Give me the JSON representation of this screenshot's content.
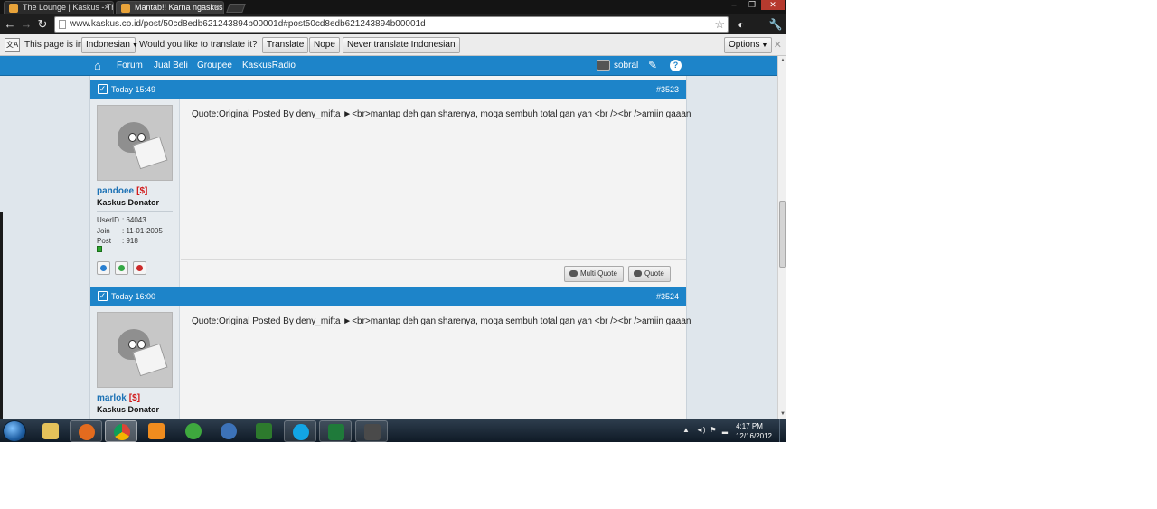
{
  "browser": {
    "tabs": [
      {
        "title": "The Lounge | Kaskus - The",
        "active": false
      },
      {
        "title": "Mantab!! Karna ngaskus d",
        "active": true
      }
    ],
    "url": "www.kaskus.co.id/post/50cd8edb621243894b00001d#post50cd8edb621243894b00001d"
  },
  "translate_bar": {
    "prefix": "This page is in",
    "language": "Indonesian",
    "question": "Would you like to translate it?",
    "translate_label": "Translate",
    "nope_label": "Nope",
    "never_label": "Never translate Indonesian",
    "options_label": "Options"
  },
  "site_nav": {
    "links": [
      "Forum",
      "Jual Beli",
      "Groupee",
      "KaskusRadio"
    ],
    "username": "sobral"
  },
  "posts": [
    {
      "time": "Today 15:49",
      "number": "#3523",
      "user": {
        "name": "pandoee",
        "tag": "[$]",
        "rank": "Kaskus Donator",
        "stats": [
          {
            "key": "UserID",
            "value": ": 64043"
          },
          {
            "key": "Join",
            "value": ": 11-01-2005"
          },
          {
            "key": "Post",
            "value": ": 918"
          }
        ]
      },
      "text": "Quote:Original Posted By deny_mifta ►<br>mantap deh gan sharenya, moga sembuh total gan yah <br /><br />amiin gaaan",
      "buttons": {
        "multi_quote": "Multi Quote",
        "quote": "Quote"
      }
    },
    {
      "time": "Today 16:00",
      "number": "#3524",
      "user": {
        "name": "marlok",
        "tag": "[$]",
        "rank": "Kaskus Donator"
      },
      "text": "Quote:Original Posted By deny_mifta ►<br>mantap deh gan sharenya, moga sembuh total gan yah <br /><br />amiin gaaan"
    }
  ],
  "taskbar": {
    "items": [
      "explorer",
      "firefox",
      "chrome",
      "media-player",
      "network-app",
      "m-app",
      "xbox-app",
      "skype",
      "excel",
      "media-player-classic"
    ],
    "clock_time": "4:17 PM",
    "clock_date": "12/16/2012"
  },
  "colors": {
    "kaskus_blue": "#1d84c9",
    "donor_red": "#d11a1a",
    "username_blue": "#1d72b5"
  }
}
